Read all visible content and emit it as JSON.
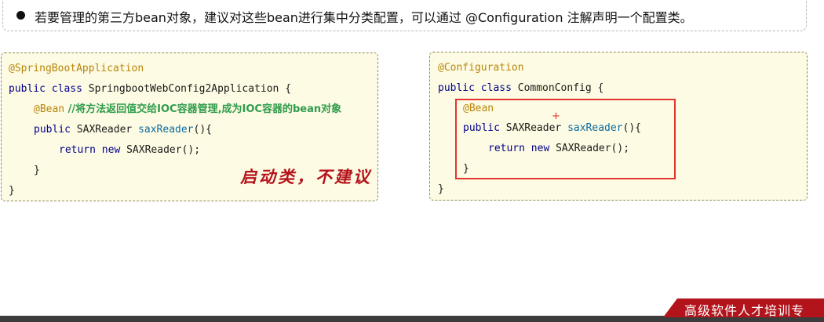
{
  "note": {
    "text": "若要管理的第三方bean对象，建议对这些bean进行集中分类配置，可以通过 @Configuration 注解声明一个配置类。"
  },
  "left_code": {
    "annotation": "@SpringBootApplication",
    "class_kw": "public class",
    "class_name": " SpringbootWebConfig2Application {",
    "bean_anno": "@Bean",
    "bean_comment": " //将方法返回值交给IOC容器管理,成为IOC容器的bean对象",
    "method_kw": "public",
    "method_type": " SAXReader ",
    "method_name": "saxReader",
    "method_sig": "(){",
    "return_kw": "return new",
    "return_val": " SAXReader();",
    "method_close": "}",
    "class_close": "}"
  },
  "right_code": {
    "annotation": "@Configuration",
    "class_kw": "public class",
    "class_name": " CommonConfig {",
    "bean_anno": "@Bean",
    "method_kw": "public",
    "method_type": " SAXReader ",
    "method_name": "saxReader",
    "method_sig": "(){",
    "return_kw": "return new",
    "return_val": " SAXReader();",
    "method_close": "}",
    "class_close": "}"
  },
  "handwritten_note": "启动类，不建议",
  "cursor_glyph": "+",
  "brand_text": "高级软件人才培训专",
  "colors": {
    "annotation": "#b8860b",
    "keyword": "#00008b",
    "method": "#0a6aa1",
    "comment": "#2e9c4c",
    "highlight_border": "#e3342f",
    "code_bg": "#fdfbe3",
    "banner": "#b3141c"
  }
}
